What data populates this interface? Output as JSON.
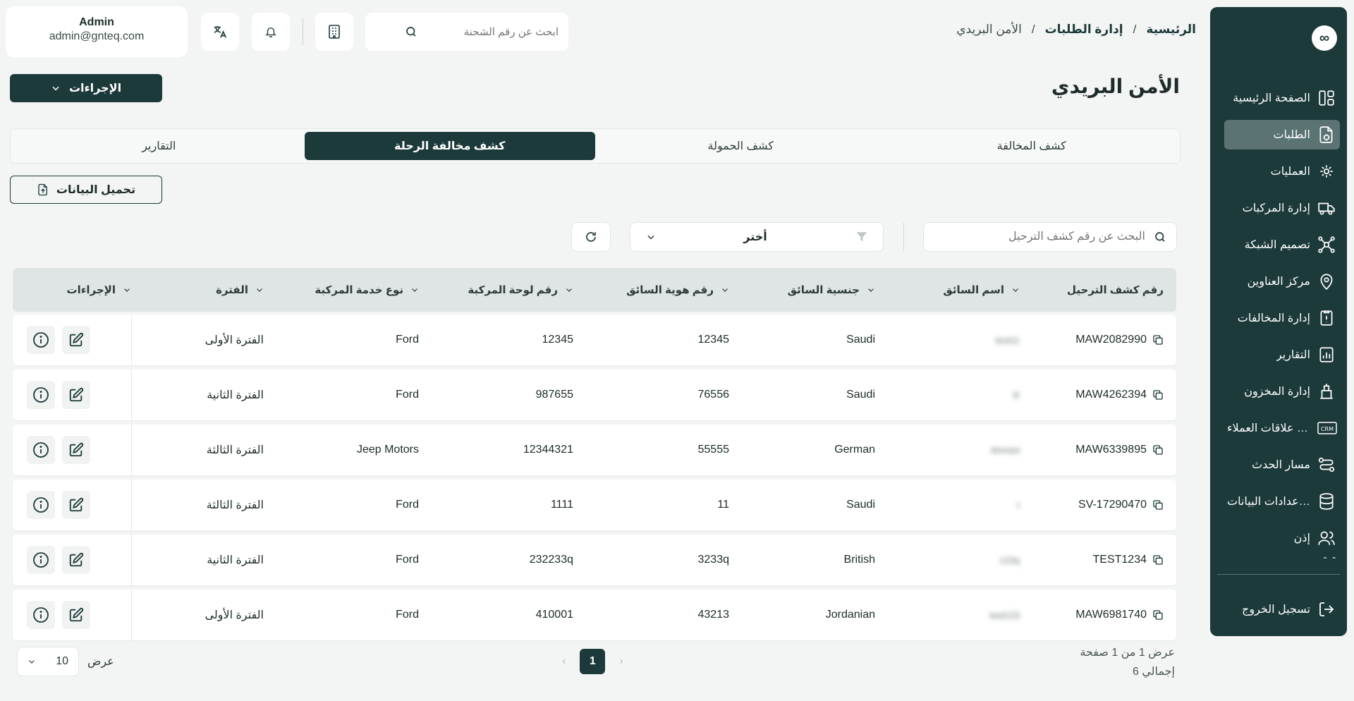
{
  "header": {
    "breadcrumb": [
      "الرئيسية",
      "إدارة الطلبات",
      "الأمن البريدي"
    ],
    "breadcrumb_sep": "/",
    "search_placeholder": "ابحث عن رقم الشحنة",
    "user": {
      "name": "Admin",
      "email": "admin@gnteq.com"
    }
  },
  "sidebar": {
    "logo": "∞",
    "items": [
      {
        "label": "الصفحة الرئيسية",
        "icon": "dashboard-icon",
        "active": false
      },
      {
        "label": "الطلبات",
        "icon": "orders-icon",
        "active": true
      },
      {
        "label": "العمليات",
        "icon": "operations-icon",
        "active": false
      },
      {
        "label": "إدارة المركبات",
        "icon": "truck-icon",
        "active": false
      },
      {
        "label": "تصميم الشبكة",
        "icon": "network-icon",
        "active": false
      },
      {
        "label": "مركز العناوين",
        "icon": "map-pin-icon",
        "active": false
      },
      {
        "label": "إدارة المخالفات",
        "icon": "violations-icon",
        "active": false
      },
      {
        "label": "التقارير",
        "icon": "reports-icon",
        "active": false
      },
      {
        "label": "إدارة المخزون",
        "icon": "inventory-icon",
        "active": false
      },
      {
        "label": "إدارة علاقات العملاء",
        "icon": "crm-icon",
        "active": false
      },
      {
        "label": "مسار الحدث",
        "icon": "event-path-icon",
        "active": false
      },
      {
        "label": "اعدادات البيانات...",
        "icon": "database-icon",
        "active": false
      },
      {
        "label": "إذن",
        "icon": "users-icon",
        "active": false
      }
    ],
    "more": "ˆ ˆ",
    "logout": "تسجيل الخروج"
  },
  "page": {
    "title": "الأمن البريدي",
    "actions_label": "الإجراءات",
    "upload_label": "تحميل البيانات"
  },
  "tabs": [
    {
      "label": "كشف المخالفة",
      "active": false
    },
    {
      "label": "كشف الحمولة",
      "active": false
    },
    {
      "label": "كشف مخالفة الرحلة",
      "active": true
    },
    {
      "label": "التقارير",
      "active": false
    }
  ],
  "filters": {
    "search_placeholder": "البحث عن رقم كشف الترحيل",
    "select_value": "أختر"
  },
  "table": {
    "columns": [
      "رقم كشف الترحيل",
      "اسم السائق",
      "جنسية السائق",
      "رقم هوية السائق",
      "رقم لوحة المركبة",
      "نوع خدمة المركبة",
      "الفترة",
      "الإجراءات"
    ],
    "rows": [
      {
        "id": "MAW2082990",
        "driver": "test11",
        "nationality": "Saudi",
        "driver_id": "12345",
        "plate": "12345",
        "service": "Ford",
        "period": "الفترة الأولى"
      },
      {
        "id": "MAW4262394",
        "driver": "R",
        "nationality": "Saudi",
        "driver_id": "76556",
        "plate": "987655",
        "service": "Ford",
        "period": "الفترة الثانية"
      },
      {
        "id": "MAW6339895",
        "driver": "Ahmed",
        "nationality": "German",
        "driver_id": "55555",
        "plate": "12344321",
        "service": "Jeep Motors",
        "period": "الفترة الثالثة"
      },
      {
        "id": "SV-17290470",
        "driver": "t",
        "nationality": "Saudi",
        "driver_id": "11",
        "plate": "1111",
        "service": "Ford",
        "period": "الفترة الثالثة"
      },
      {
        "id": "TEST1234",
        "driver": "123q",
        "nationality": "British",
        "driver_id": "3233q",
        "plate": "232233q",
        "service": "Ford",
        "period": "الفترة الثانية"
      },
      {
        "id": "MAW6981740",
        "driver": "test123",
        "nationality": "Jordanian",
        "driver_id": "43213",
        "plate": "410001",
        "service": "Ford",
        "period": "الفترة الأولى"
      }
    ]
  },
  "pagination": {
    "info": "عرض 1 من 1 صفحة",
    "total": "إجمالي 6",
    "current_page": "1",
    "page_size_label": "عرض",
    "page_size": "10"
  },
  "colors": {
    "primary": "#1c3a3a",
    "background": "#f3f5f4",
    "sidebar_active": "#5b7373"
  }
}
